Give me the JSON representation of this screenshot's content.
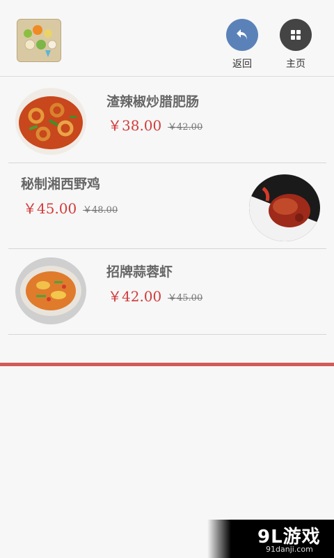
{
  "header": {
    "logo_icon": "app-logo-icon",
    "back_label": "返回",
    "back_icon": "undo-arrow-icon",
    "home_label": "主页",
    "home_icon": "grid-icon",
    "back_color": "#5b82b8",
    "home_color": "#444444"
  },
  "dishes": [
    {
      "name": "渣辣椒炒腊肥肠",
      "price": "￥38.00",
      "old_price": "￥42.00"
    },
    {
      "name": "秘制湘西野鸡",
      "price": "￥45.00",
      "old_price": "￥48.00"
    },
    {
      "name": "招牌蒜蓉虾",
      "price": "￥42.00",
      "old_price": "￥45.00"
    }
  ],
  "watermark": {
    "brand": "9L游戏",
    "domain": "91danji.com"
  },
  "colors": {
    "price": "#d23b3b",
    "accent_line": "#d35a5a"
  }
}
